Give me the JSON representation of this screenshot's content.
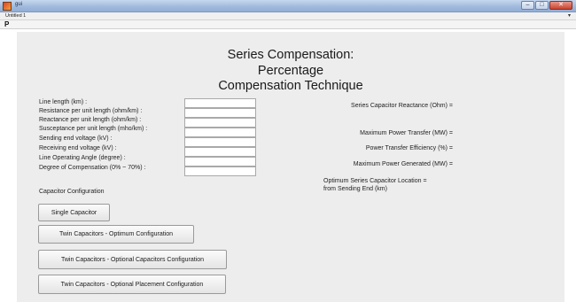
{
  "window": {
    "title": "gui",
    "controls": {
      "minimize": "–",
      "maximize": "□",
      "close": "✕"
    }
  },
  "menubar": {
    "item": "Untitled 1",
    "arrow": "▾"
  },
  "toolbar": {
    "tool": "P"
  },
  "heading": {
    "line1": "Series Compensation:",
    "line2": "Percentage",
    "line3": "Compensation Technique"
  },
  "inputs": [
    {
      "label": "Line length (km) :",
      "value": ""
    },
    {
      "label": "Resistance per unit length (ohm/km) :",
      "value": ""
    },
    {
      "label": "Reactance per unit length (ohm/km) :",
      "value": ""
    },
    {
      "label": "Susceptance per unit length (mho/km) :",
      "value": ""
    },
    {
      "label": "Sending end voltage (kV) :",
      "value": ""
    },
    {
      "label": "Receiving end voltage (kV) :",
      "value": ""
    },
    {
      "label": "Line Operating Angle (degree) :",
      "value": ""
    },
    {
      "label": "Degree of Compensation (0% ~ 70%) :",
      "value": ""
    }
  ],
  "outputs": {
    "reactance": "Series Capacitor Reactance (Ohm) =",
    "max_power": "Maximum Power Transfer (MW) =",
    "efficiency": "Power Transfer Efficiency (%) =",
    "max_generated": "Maximum Power Generated (MW) =",
    "location_line1": "Optimum Series Capacitor Location  =",
    "location_line2": "from Sending End (km)"
  },
  "capacitor_config": {
    "label": "Capacitor Configuration",
    "buttons": {
      "single": "Single Capacitor",
      "twin_optimum": "Twin Capacitors - Optimum Configuration",
      "twin_optional_caps": "Twin Capacitors - Optional Capacitors Configuration",
      "twin_optional_placement": "Twin Capacitors - Optional Placement Configuration"
    }
  }
}
